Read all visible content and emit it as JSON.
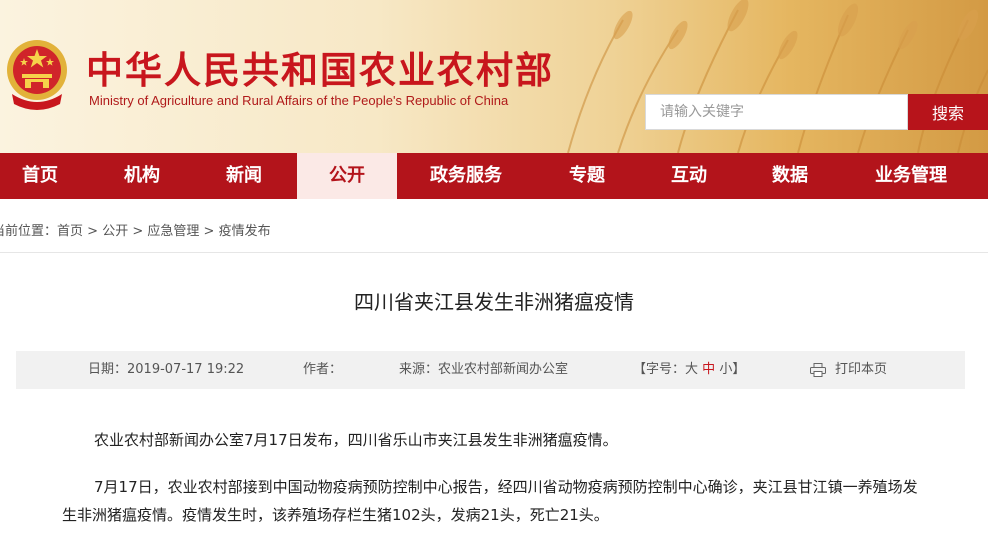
{
  "header": {
    "title": "中华人民共和国农业农村部",
    "subtitle": "Ministry of Agriculture and Rural Affairs of the People's Republic of China",
    "search_placeholder": "请输入关键字",
    "search_button": "搜索"
  },
  "nav": {
    "items": [
      {
        "label": "首页"
      },
      {
        "label": "机构"
      },
      {
        "label": "新闻"
      },
      {
        "label": "公开",
        "active": true
      },
      {
        "label": "政务服务"
      },
      {
        "label": "专题"
      },
      {
        "label": "互动"
      },
      {
        "label": "数据"
      },
      {
        "label": "业务管理"
      }
    ]
  },
  "breadcrumb": {
    "prefix": "当前位置：",
    "items": [
      "首页",
      "公开",
      "应急管理",
      "疫情发布"
    ],
    "separator": " > "
  },
  "article": {
    "title": "四川省夹江县发生非洲猪瘟疫情",
    "meta": {
      "date_label": "日期：",
      "date": "2019-07-17 19:22",
      "author_label": "作者：",
      "author": "",
      "source_label": "来源：",
      "source": "农业农村部新闻办公室",
      "font_size_label": "【字号：",
      "size_large": "大",
      "size_medium": "中",
      "size_small": "小",
      "font_size_close": "】",
      "print_label": "打印本页"
    },
    "paragraphs": [
      "农业农村部新闻办公室7月17日发布，四川省乐山市夹江县发生非洲猪瘟疫情。",
      "7月17日，农业农村部接到中国动物疫病预防控制中心报告，经四川省动物疫病预防控制中心确诊，夹江县甘江镇一养殖场发生非洲猪瘟疫情。疫情发生时，该养殖场存栏生猪102头，发病21头，死亡21头。"
    ]
  },
  "colors": {
    "brand_red": "#b3141b",
    "title_red": "#c8161d",
    "active_nav_bg": "#fbe9e6"
  },
  "icons": {
    "emblem": "national-emblem",
    "print": "printer-icon"
  }
}
